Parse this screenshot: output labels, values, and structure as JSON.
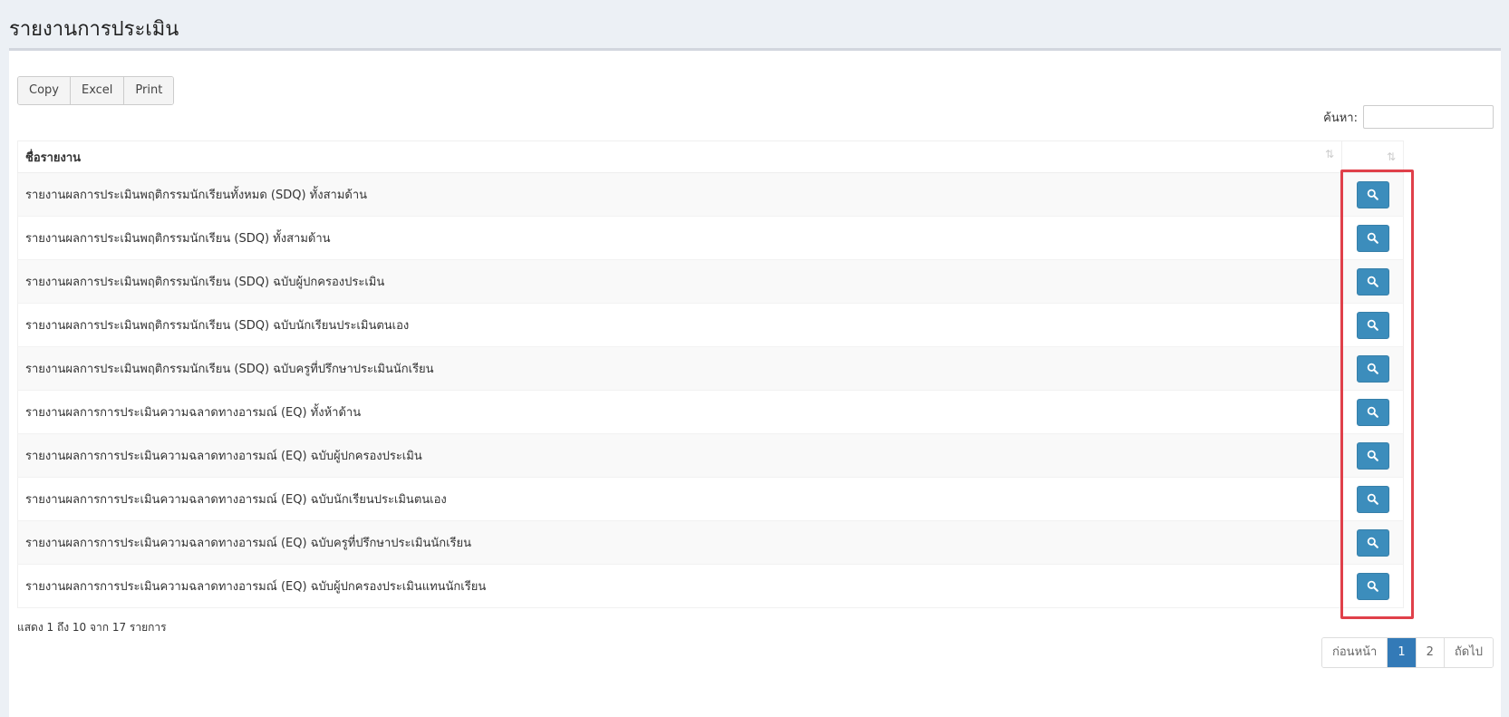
{
  "header": {
    "title": "รายงานการประเมิน"
  },
  "toolbar": {
    "copy_label": "Copy",
    "excel_label": "Excel",
    "print_label": "Print"
  },
  "search": {
    "label": "ค้นหา:",
    "value": ""
  },
  "table": {
    "column_header": "ชื่อรายงาน",
    "sort_icon": "⇅",
    "rows": [
      "รายงานผลการประเมินพฤติกรรมนักเรียนทั้งหมด (SDQ) ทั้งสามด้าน",
      "รายงานผลการประเมินพฤติกรรมนักเรียน (SDQ) ทั้งสามด้าน",
      "รายงานผลการประเมินพฤติกรรมนักเรียน (SDQ) ฉบับผู้ปกครองประเมิน",
      "รายงานผลการประเมินพฤติกรรมนักเรียน (SDQ) ฉบับนักเรียนประเมินตนเอง",
      "รายงานผลการประเมินพฤติกรรมนักเรียน (SDQ) ฉบับครูที่ปรึกษาประเมินนักเรียน",
      "รายงานผลการการประเมินความฉลาดทางอารมณ์ (EQ) ทั้งห้าด้าน",
      "รายงานผลการการประเมินความฉลาดทางอารมณ์ (EQ) ฉบับผู้ปกครองประเมิน",
      "รายงานผลการการประเมินความฉลาดทางอารมณ์ (EQ) ฉบับนักเรียนประเมินตนเอง",
      "รายงานผลการการประเมินความฉลาดทางอารมณ์ (EQ) ฉบับครูที่ปรึกษาประเมินนักเรียน",
      "รายงานผลการการประเมินความฉลาดทางอารมณ์ (EQ) ฉบับผู้ปกครองประเมินแทนนักเรียน"
    ]
  },
  "info": "แสดง 1 ถึง 10 จาก 17 รายการ",
  "pagination": {
    "prev": "ก่อนหน้า",
    "page1": "1",
    "page2": "2",
    "next": "ถัดไป"
  },
  "colors": {
    "accent": "#3c8dbc",
    "highlight": "#e0404a",
    "active_page": "#337ab7"
  }
}
